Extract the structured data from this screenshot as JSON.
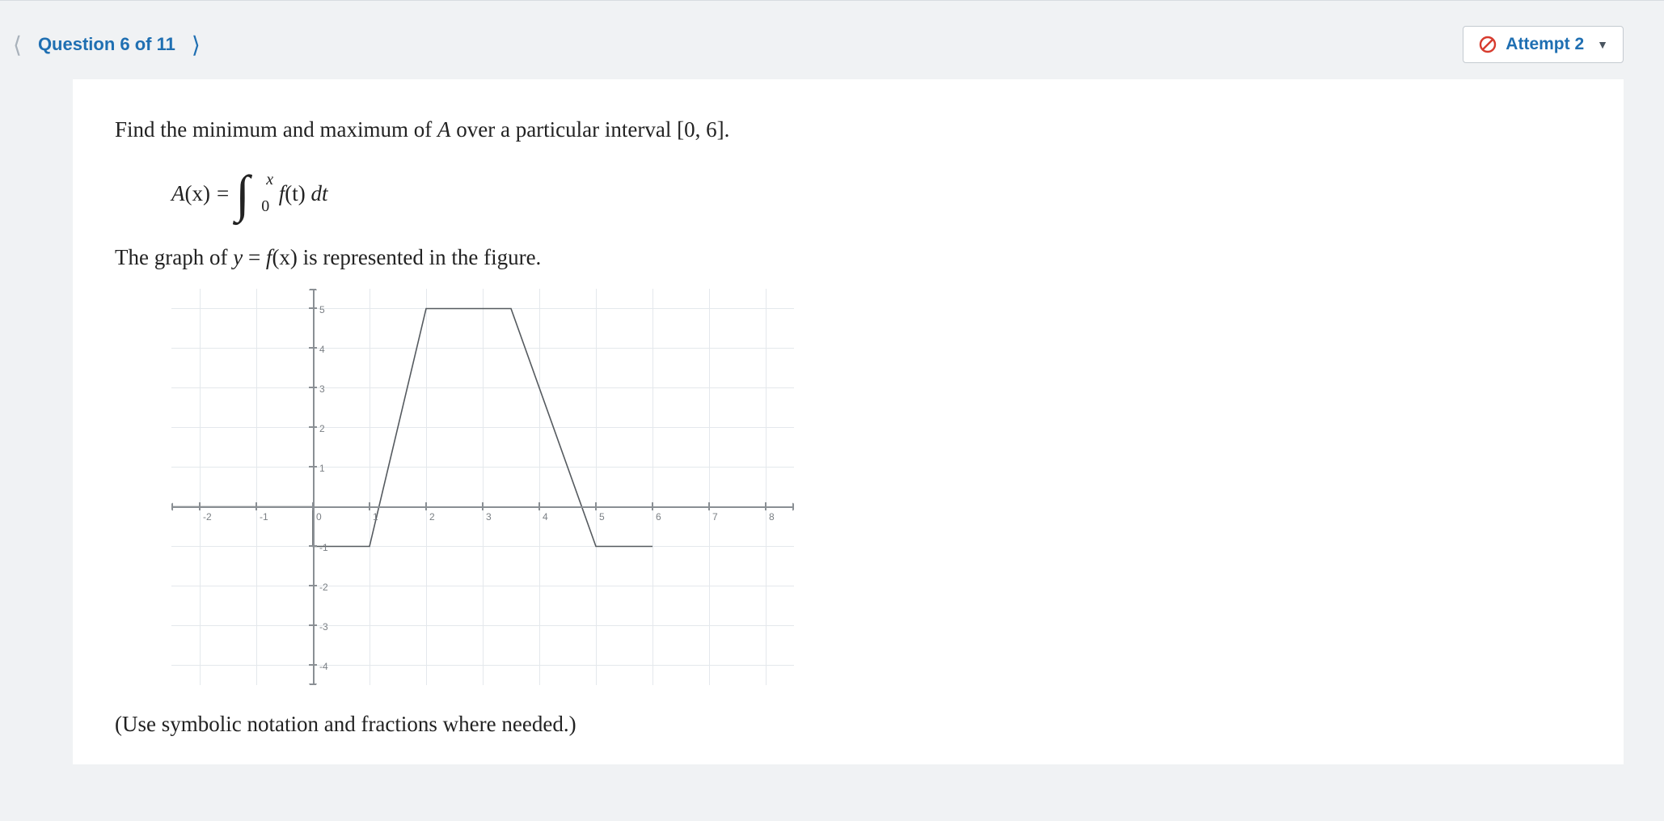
{
  "header": {
    "question_label": "Question 6 of 11",
    "attempt_label": "Attempt 2"
  },
  "problem": {
    "statement_prefix": "Find the minimum and maximum of ",
    "statement_A": "A",
    "statement_mid": " over a particular interval ",
    "statement_interval": "[0, 6].",
    "formula_lhs_A": "A",
    "formula_lhs_x": "(x)",
    "formula_eq": " = ",
    "int_upper": "x",
    "int_lower": "0",
    "integrand_f": "f",
    "integrand_t": "(t)",
    "integrand_dt": " dt",
    "graph_intro_prefix": "The graph of ",
    "graph_intro_y": "y",
    "graph_intro_eq": " = ",
    "graph_intro_f": "f",
    "graph_intro_x": "(x)",
    "graph_intro_suffix": " is represented in the figure.",
    "instruction": "(Use symbolic notation and fractions where needed.)"
  },
  "chart_data": {
    "type": "line",
    "xlim": [
      -2.5,
      8.5
    ],
    "ylim": [
      -4.5,
      5.5
    ],
    "x_ticks": [
      -2,
      -1,
      0,
      1,
      2,
      3,
      4,
      5,
      6,
      7,
      8
    ],
    "y_ticks": [
      -4,
      -3,
      -2,
      -1,
      0,
      1,
      2,
      3,
      4,
      5
    ],
    "series": [
      {
        "name": "f(x)",
        "points": [
          [
            -2.5,
            0
          ],
          [
            0,
            0
          ],
          [
            0,
            -1
          ],
          [
            1,
            -1
          ],
          [
            2,
            5
          ],
          [
            3.5,
            5
          ],
          [
            5,
            -1
          ],
          [
            6,
            -1
          ]
        ]
      }
    ]
  }
}
